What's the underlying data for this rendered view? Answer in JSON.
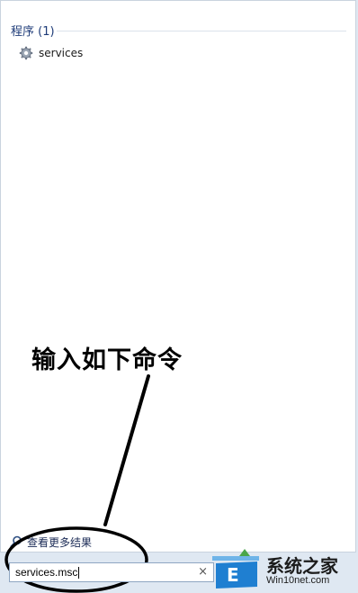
{
  "results": {
    "section_title": "程序 (1)",
    "items": [
      {
        "label": "services",
        "icon": "gear-icon"
      }
    ]
  },
  "annotation": {
    "text": "输入如下命令"
  },
  "more_results": {
    "label": "查看更多结果",
    "icon": "search-icon"
  },
  "search": {
    "value": "services.msc",
    "clear_icon": "×"
  },
  "watermark": {
    "title": "系统之家",
    "url": "Win10net.com"
  },
  "colors": {
    "section_title": "#1e3b78",
    "panel_bg": "#ffffff",
    "outer_bg": "#dfe8f2"
  }
}
